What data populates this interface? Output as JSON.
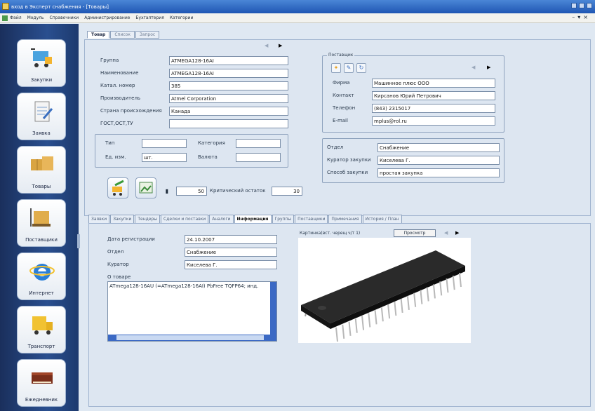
{
  "window": {
    "title": "вход в Эксперт снабжения - [Товары]"
  },
  "menu": [
    "Файл",
    "Модуль",
    "Справочники",
    "Администрирование",
    "Бухгалтерия",
    "Категории"
  ],
  "sidebar": {
    "items": [
      {
        "label": "Закупки",
        "icon": "cart-icon"
      },
      {
        "label": "Заявка",
        "icon": "clipboard-icon"
      },
      {
        "label": "Товары",
        "icon": "boxes-icon"
      },
      {
        "label": "Поставщики",
        "icon": "pallet-icon"
      },
      {
        "label": "Интернет",
        "icon": "internet-explorer-icon"
      },
      {
        "label": "Транспорт",
        "icon": "truck-icon"
      },
      {
        "label": "Ежедневник",
        "icon": "diary-icon"
      }
    ]
  },
  "top_tabs": [
    "Товар",
    "Список",
    "Запрос"
  ],
  "product": {
    "group_label": "Группа",
    "group": "ATMEGA128-16AI",
    "name_label": "Наименование",
    "name": "ATMEGA128-16AI",
    "catalog_label": "Катал. номер",
    "catalog": "385",
    "maker_label": "Производитель",
    "maker": "Atmel Corporation",
    "country_label": "Страна происхождения",
    "country": "Канада",
    "gost_label": "ГОСТ,ОСТ,ТУ",
    "gost": "",
    "type_label": "Тип",
    "type": "",
    "unit_label": "Ед. изм.",
    "unit": "шт.",
    "category_label": "Категория",
    "category": "",
    "currency_label": "Валюта",
    "currency": ""
  },
  "supplier": {
    "title": "Поставщик",
    "firm_label": "Фирма",
    "firm": "Машинное плюс ООО",
    "contact_label": "Контакт",
    "contact": "Кирсанов Юрий Петрович",
    "phone_label": "Телефон",
    "phone": "(843) 2315017",
    "email_label": "E-mail",
    "email": "mplus@rol.ru"
  },
  "department": {
    "dept_label": "Отдел",
    "dept": "Снабжение",
    "curator_label": "Куратор закупки",
    "curator": "Киселева Г.",
    "method_label": "Способ закупки",
    "method": "простая закупка"
  },
  "stock": {
    "quantity": "50",
    "critical_label": "Критический остаток",
    "critical": "30"
  },
  "bottom_tabs": [
    "Заявки",
    "Закупки",
    "Тендеры",
    "Сделки и поставки",
    "Аналоги",
    "Информация",
    "Группы",
    "Поставщики",
    "Примечания",
    "История / План"
  ],
  "info": {
    "reg_date_label": "Дата регистрации",
    "reg_date": "24.10.2007",
    "dept_label": "Отдел",
    "dept": "Снабжение",
    "curator_label": "Куратор",
    "curator": "Киселева Г.",
    "about_label": "О товаре",
    "about_text": "ATmega128-16AU (=ATmega128-16AI) PbFree TQFP64; инд.",
    "picture_label": "Картинка(вст. черещ ч/т 1)",
    "view_button": "Просмотр"
  }
}
